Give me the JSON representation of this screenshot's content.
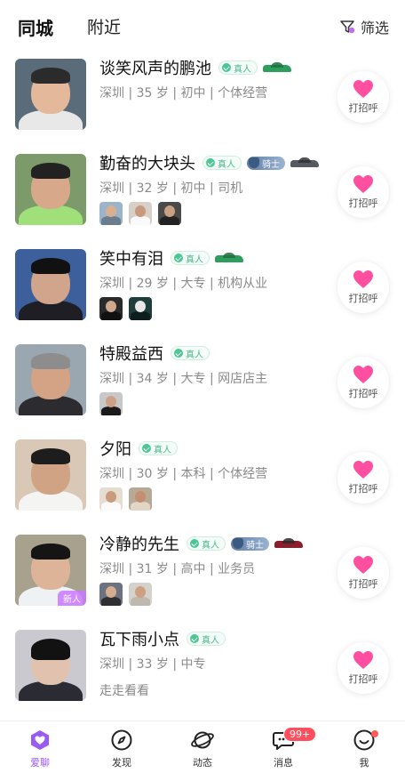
{
  "header": {
    "tab_same_city": "同城",
    "tab_nearby": "附近",
    "filter_label": "筛选"
  },
  "users": [
    {
      "name": "谈笑风声的鹏池",
      "real": "真人",
      "knight": "",
      "car_color": "#2e9e5e",
      "info": "深圳 | 35 岁 | 初中 | 个体经营",
      "photos": 0,
      "motto": "",
      "new_tag": ""
    },
    {
      "name": "勤奋的大块头",
      "real": "真人",
      "knight": "骑士",
      "car_color": "#555a60",
      "info": "深圳 | 32 岁 | 初中 | 司机",
      "photos": 3,
      "motto": "",
      "new_tag": ""
    },
    {
      "name": "笑中有泪",
      "real": "真人",
      "knight": "",
      "car_color": "#2e9e5e",
      "info": "深圳 | 29 岁 | 大专 | 机构从业",
      "photos": 2,
      "motto": "",
      "new_tag": ""
    },
    {
      "name": "特殿益西",
      "real": "真人",
      "knight": "",
      "car_color": "",
      "info": "深圳 | 34 岁 | 大专 | 网店店主",
      "photos": 1,
      "motto": "",
      "new_tag": ""
    },
    {
      "name": "夕阳",
      "real": "真人",
      "knight": "",
      "car_color": "",
      "info": "深圳 | 30 岁 | 本科 | 个体经营",
      "photos": 2,
      "motto": "",
      "new_tag": ""
    },
    {
      "name": "冷静的先生",
      "real": "真人",
      "knight": "骑士",
      "car_color": "#8b1e2a",
      "info": "深圳 | 31 岁 | 高中 | 业务员",
      "photos": 2,
      "motto": "",
      "new_tag": "新人"
    },
    {
      "name": "瓦下雨小点",
      "real": "真人",
      "knight": "",
      "car_color": "",
      "info": "深圳 | 33 岁 | 中专",
      "photos": 0,
      "motto": "走走看看",
      "new_tag": ""
    }
  ],
  "greet_label": "打招呼",
  "nav": {
    "love": "爱聊",
    "discover": "发现",
    "moments": "动态",
    "messages": "消息",
    "messages_badge": "99+",
    "me": "我"
  },
  "colors": {
    "accent": "#9a5cf0",
    "heart": "#ff4fa0",
    "real_badge": "#4bc694",
    "badge_red": "#ff4f5e"
  }
}
